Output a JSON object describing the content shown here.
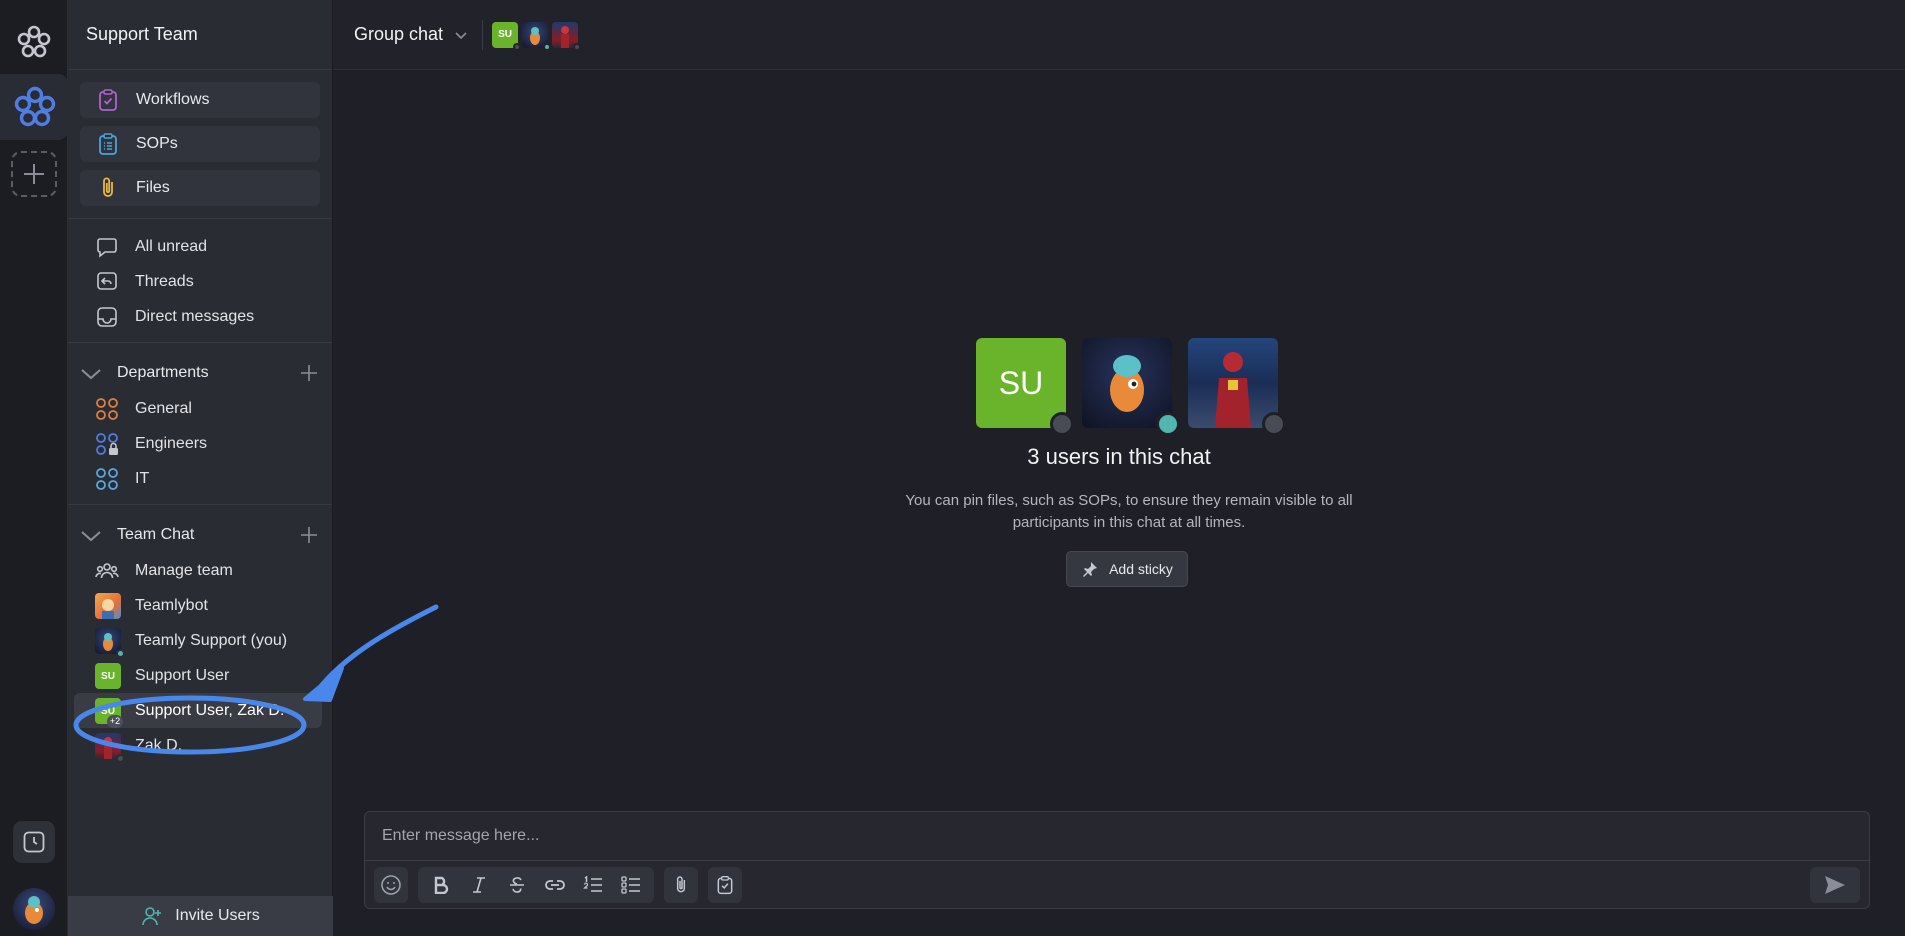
{
  "sidebar": {
    "team_name": "Support Team",
    "pills": [
      {
        "label": "Workflows",
        "icon": "clipboard-check-icon"
      },
      {
        "label": "SOPs",
        "icon": "clipboard-list-icon"
      },
      {
        "label": "Files",
        "icon": "paperclip-icon"
      }
    ],
    "nav": [
      {
        "label": "All unread",
        "icon": "chat-bubble-icon"
      },
      {
        "label": "Threads",
        "icon": "thread-reply-icon"
      },
      {
        "label": "Direct messages",
        "icon": "inbox-icon"
      }
    ],
    "departments": {
      "title": "Departments",
      "items": [
        {
          "label": "General",
          "color": "#e0803f"
        },
        {
          "label": "Engineers",
          "color": "#4f7de0"
        },
        {
          "label": "IT",
          "color": "#5aa7e0"
        }
      ]
    },
    "team_chat": {
      "title": "Team Chat",
      "items": [
        {
          "label": "Manage team"
        },
        {
          "label": "Teamlybot"
        },
        {
          "label": "Teamly Support (you)"
        },
        {
          "label": "Support User",
          "initials": "SU"
        },
        {
          "label": "Support User, Zak D.",
          "initials": "SU",
          "badge": "+2"
        },
        {
          "label": "Zak D."
        }
      ]
    },
    "invite_label": "Invite Users"
  },
  "header": {
    "title": "Group chat",
    "avatar_initials": "SU"
  },
  "empty_state": {
    "avatar_initials": "SU",
    "users_count": "3 users in this chat",
    "helper": "You can pin files, such as SOPs, to ensure they remain visible to all participants in this chat at all times.",
    "add_sticky": "Add sticky"
  },
  "composer": {
    "placeholder": "Enter message here..."
  },
  "colors": {
    "accent": "#4f7de0",
    "online": "#4fb6b0",
    "offline": "#4a4c55",
    "su_green": "#6ab42c",
    "annotation": "#4a87ea"
  }
}
